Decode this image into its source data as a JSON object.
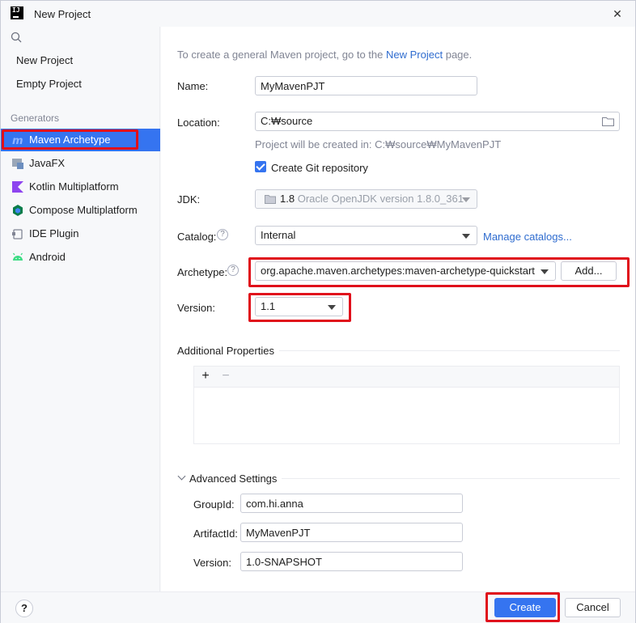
{
  "window": {
    "title": "New Project",
    "app_icon": "intellij-icon",
    "close_label": "✕"
  },
  "sidebar": {
    "top_items": [
      {
        "label": "New Project"
      },
      {
        "label": "Empty Project"
      }
    ],
    "generators_label": "Generators",
    "generators": [
      {
        "label": "Maven Archetype",
        "icon": "maven-icon",
        "icon_color": "#3574f0",
        "selected": true
      },
      {
        "label": "JavaFX",
        "icon": "javafx-icon",
        "icon_color": "#6c8ebf"
      },
      {
        "label": "Kotlin Multiplatform",
        "icon": "kotlin-icon",
        "icon_color": "#8e44ef"
      },
      {
        "label": "Compose Multiplatform",
        "icon": "compose-icon",
        "icon_color": "#0a7d4a"
      },
      {
        "label": "IDE Plugin",
        "icon": "plugin-icon",
        "icon_color": "#818594"
      },
      {
        "label": "Android",
        "icon": "android-icon",
        "icon_color": "#3ddc84"
      }
    ]
  },
  "main": {
    "hint_prefix": "To create a general Maven project, go to the",
    "hint_link": "New Project",
    "hint_suffix": "page.",
    "name": {
      "label": "Name:",
      "value": "MyMavenPJT"
    },
    "location": {
      "label": "Location:",
      "value": "C:₩source",
      "note": "Project will be created in: C:₩source₩MyMavenPJT"
    },
    "git": {
      "label": "Create Git repository",
      "checked": true
    },
    "jdk": {
      "label": "JDK:",
      "version": "1.8",
      "detail": "Oracle OpenJDK version 1.8.0_361"
    },
    "catalog": {
      "label": "Catalog:",
      "value": "Internal",
      "manage_link": "Manage catalogs..."
    },
    "archetype": {
      "label": "Archetype:",
      "value": "org.apache.maven.archetypes:maven-archetype-quickstart",
      "add_label": "Add..."
    },
    "version": {
      "label": "Version:",
      "value": "1.1"
    },
    "additional": {
      "title": "Additional Properties",
      "add_symbol": "+",
      "remove_symbol": "−"
    },
    "advanced": {
      "title": "Advanced Settings",
      "groupid": {
        "label": "GroupId:",
        "value": "com.hi.anna"
      },
      "artifactid": {
        "label": "ArtifactId:",
        "value": "MyMavenPJT"
      },
      "version": {
        "label": "Version:",
        "value": "1.0-SNAPSHOT"
      }
    }
  },
  "footer": {
    "help_label": "?",
    "create_label": "Create",
    "cancel_label": "Cancel"
  },
  "colors": {
    "accent": "#3574f0",
    "highlight_box": "#e0101b"
  }
}
